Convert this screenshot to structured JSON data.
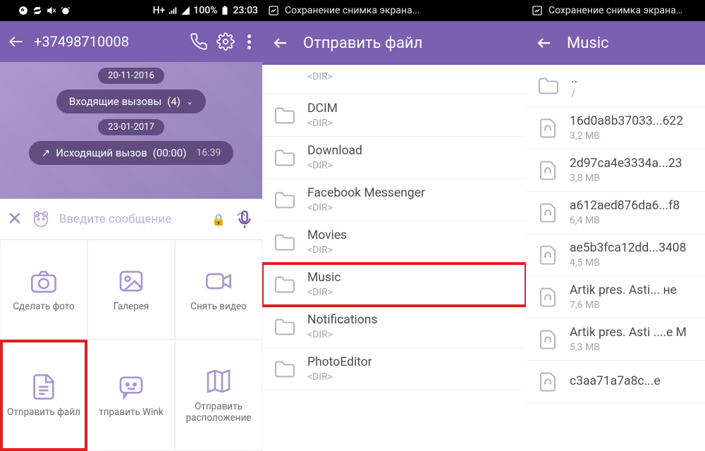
{
  "panel1": {
    "statusbar": {
      "time": "23:03",
      "battery": "100%",
      "net": "H+"
    },
    "header": {
      "phone": "+37498710008"
    },
    "chat": {
      "date1": "20-11-2016",
      "incoming": "Входящие вызовы",
      "incoming_count": "(4)",
      "date2": "23-01-2017",
      "outgoing": "Исходящий вызов",
      "outgoing_dur": "(00:00)",
      "outgoing_time": "16:39"
    },
    "input": {
      "placeholder": "Введите сообщение"
    },
    "grid": [
      {
        "label": "Сделать фото"
      },
      {
        "label": "Галерея"
      },
      {
        "label": "Снять видео"
      },
      {
        "label": "Отправить файл"
      },
      {
        "label": "тправить Wink"
      },
      {
        "label": "Отправить расположение"
      }
    ]
  },
  "panel2": {
    "statusbar": {
      "title": "Сохранение снимка экрана..."
    },
    "header": {
      "title": "Отправить файл"
    },
    "items": [
      {
        "name": "",
        "sub": "<DIR>",
        "type": "partial"
      },
      {
        "name": "DCIM",
        "sub": "<DIR>",
        "type": "folder"
      },
      {
        "name": "Download",
        "sub": "<DIR>",
        "type": "folder"
      },
      {
        "name": "Facebook Messenger",
        "sub": "<DIR>",
        "type": "folder"
      },
      {
        "name": "Movies",
        "sub": "<DIR>",
        "type": "folder"
      },
      {
        "name": "Music",
        "sub": "<DIR>",
        "type": "folder",
        "highlight": true
      },
      {
        "name": "Notifications",
        "sub": "<DIR>",
        "type": "folder"
      },
      {
        "name": "PhotoEditor",
        "sub": "<DIR>",
        "type": "folder-partial"
      }
    ]
  },
  "panel3": {
    "statusbar": {
      "title": "Сохранение снимка экрана…"
    },
    "header": {
      "title": "Music"
    },
    "items": [
      {
        "name": "..",
        "sub": "/",
        "type": "folder-up"
      },
      {
        "name": "16d0a8b37033...622",
        "sub": "3,2 MB",
        "type": "audio"
      },
      {
        "name": "2d97ca4e3334a...23",
        "sub": "3,8 MB",
        "type": "audio"
      },
      {
        "name": "a612aed876da6...f8",
        "sub": "6,4 MB",
        "type": "audio"
      },
      {
        "name": "ae5b3fca12dd...3408",
        "sub": "4,5 MB",
        "type": "audio"
      },
      {
        "name": "Artik pres. Asti... не",
        "sub": "7,6 MB",
        "type": "audio"
      },
      {
        "name": "Artik pres. Asti ....е M",
        "sub": "5,3 MB",
        "type": "audio"
      },
      {
        "name": "c3aa71a7a8c...e",
        "sub": "",
        "type": "audio-partial"
      }
    ]
  }
}
